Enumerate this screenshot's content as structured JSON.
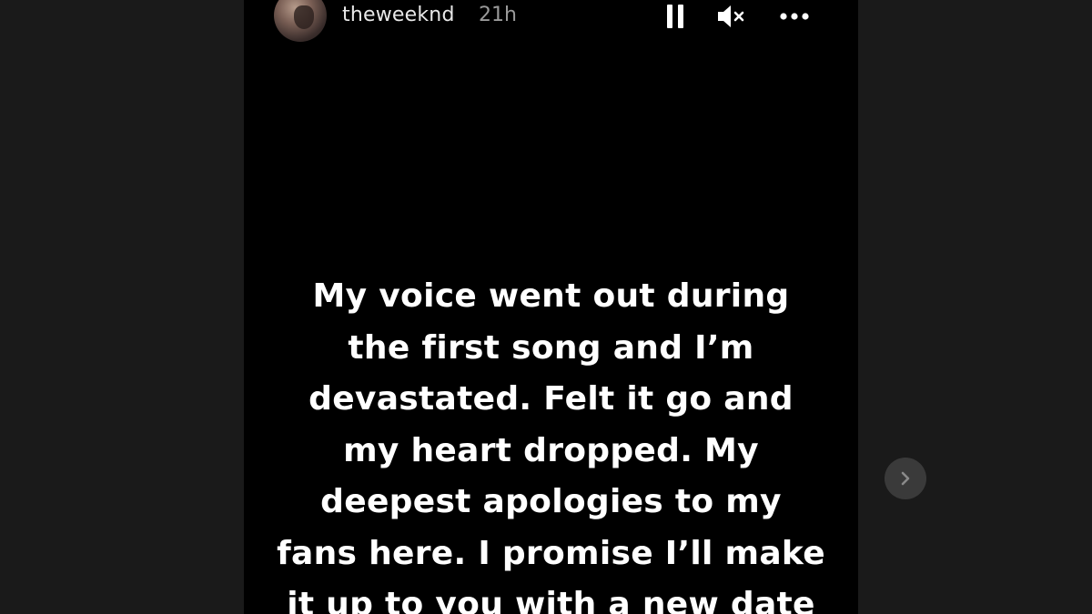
{
  "story": {
    "username": "theweeknd",
    "time_ago": "21h",
    "text_lines": [
      "My voice went out during",
      "the first song and I’m",
      "devastated. Felt it go and",
      "my heart dropped. My",
      "deepest apologies to my",
      "fans here. I promise I’ll make",
      "it up to you with a new date"
    ]
  },
  "controls": {
    "pause_icon": "pause-icon",
    "mute_icon": "muted-speaker-icon",
    "more_icon": "more-options-icon",
    "next_icon": "chevron-right-icon"
  },
  "colors": {
    "page_background": "#1a1a1a",
    "story_background": "#000000",
    "text": "#ffffff",
    "secondary_text": "#9a9a9a",
    "next_button": "#3a3a3a"
  }
}
